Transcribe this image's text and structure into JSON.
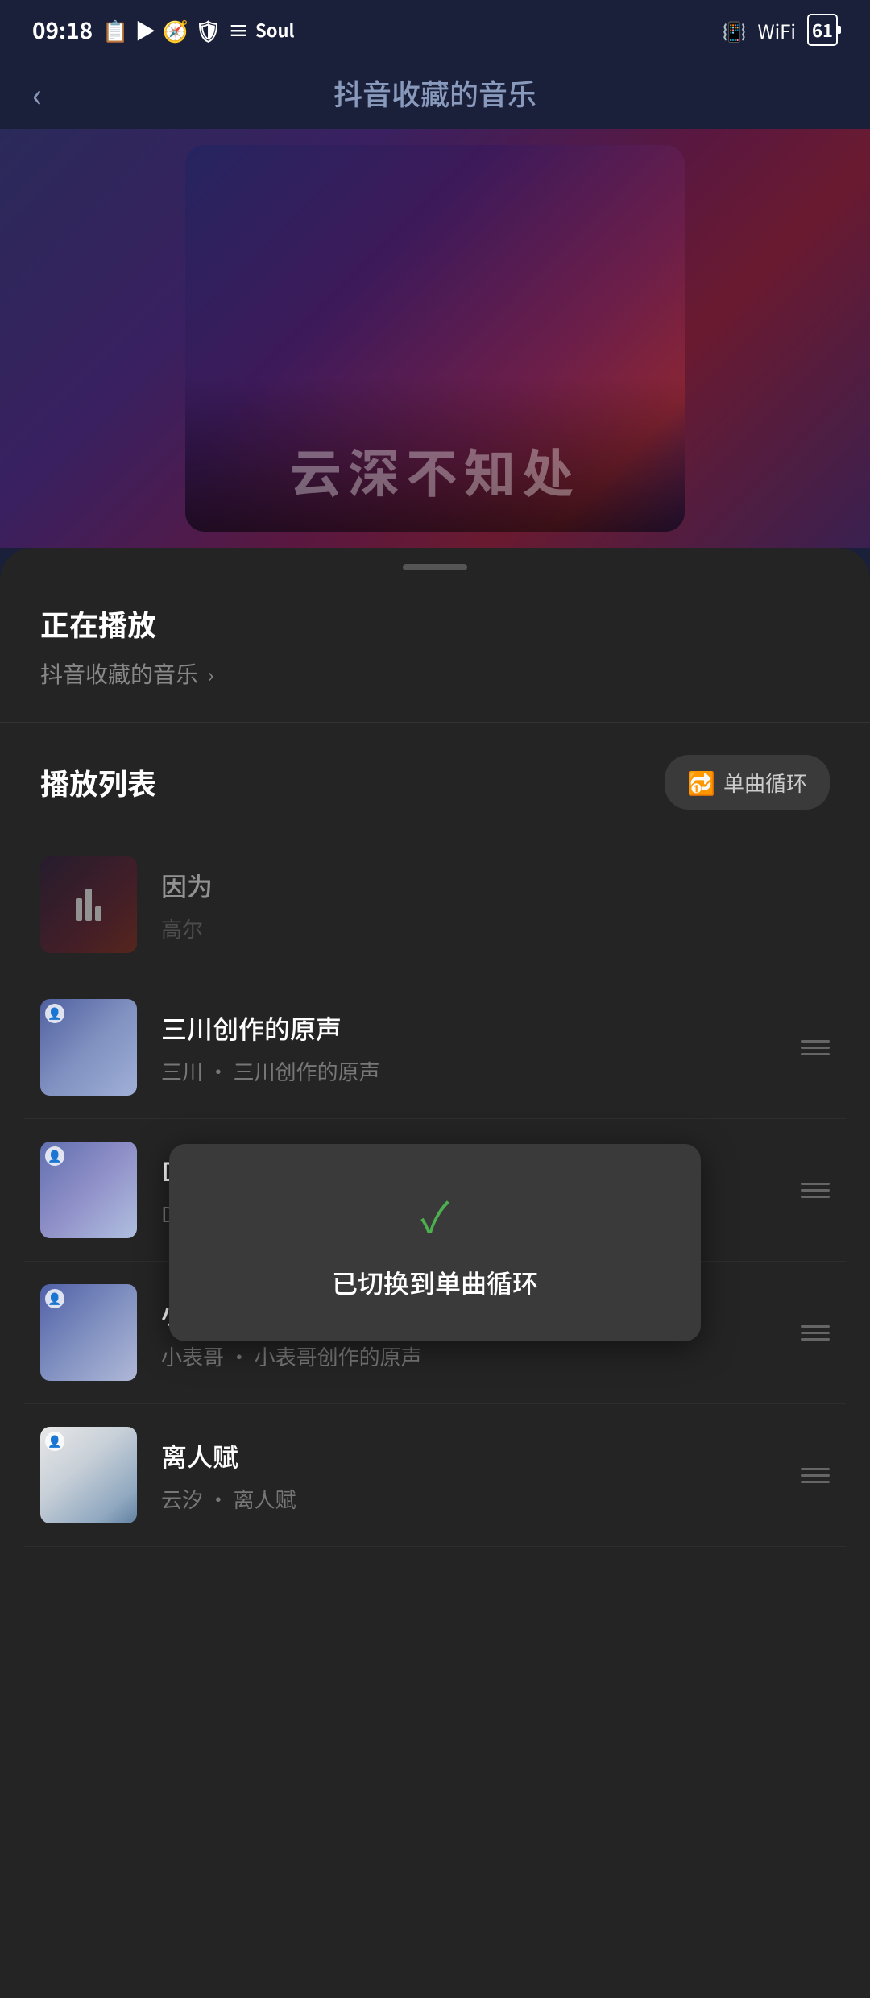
{
  "statusBar": {
    "time": "09:18",
    "batteryLevel": "61"
  },
  "header": {
    "backLabel": "‹",
    "title": "抖音收藏的音乐"
  },
  "albumText": "云深不知处",
  "bottomSheet": {
    "nowPlayingLabel": "正在播放",
    "nowPlayingSubtitle": "抖音收藏的音乐",
    "playlistTitle": "播放列表",
    "repeatButton": "单曲循环"
  },
  "tooltip": {
    "checkmark": "✓",
    "message": "已切换到单曲循环"
  },
  "songs": [
    {
      "id": 1,
      "title": "因为",
      "subtitle": "高尔",
      "thumbClass": "song-thumb-1",
      "isPlaying": true
    },
    {
      "id": 2,
      "title": "三川创作的原声",
      "subtitle": "三川 · 三川创作的原声",
      "thumbClass": "song-thumb-2",
      "isPlaying": false
    },
    {
      "id": 3,
      "title": "Duck🎵创作的原声",
      "subtitle": "Duck🎵 · Duck🎵创作的原声",
      "thumbClass": "song-thumb-3",
      "isPlaying": false
    },
    {
      "id": 4,
      "title": "小表哥创作的原声",
      "subtitle": "小表哥 · 小表哥创作的原声",
      "thumbClass": "song-thumb-4",
      "isPlaying": false
    },
    {
      "id": 5,
      "title": "离人赋",
      "subtitle": "云汐 · 离人赋",
      "thumbClass": "song-thumb-5",
      "isPlaying": false
    }
  ]
}
